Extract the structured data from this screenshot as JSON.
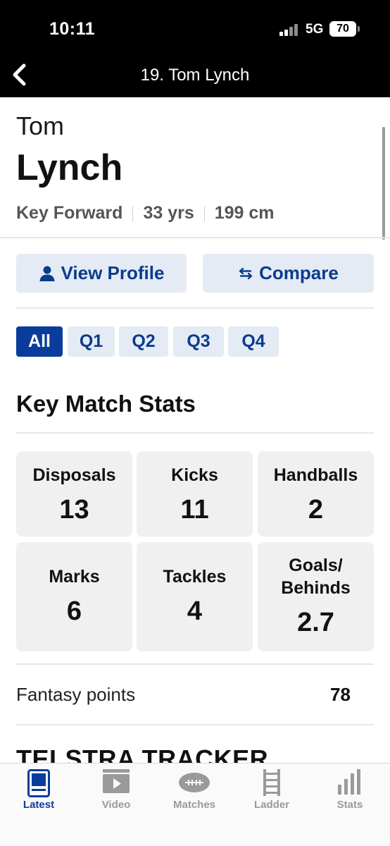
{
  "status_bar": {
    "time": "10:11",
    "network": "5G",
    "battery": "70"
  },
  "header": {
    "title": "19. Tom Lynch",
    "back_icon": "chevron-left-icon"
  },
  "player": {
    "first_name": "Tom",
    "last_name": "Lynch",
    "position": "Key Forward",
    "age": "33 yrs",
    "height": "199 cm"
  },
  "actions": {
    "view_profile": {
      "label": "View Profile",
      "icon": "person-icon"
    },
    "compare": {
      "label": "Compare",
      "icon": "swap-arrows-icon"
    }
  },
  "quarter_tabs": [
    {
      "label": "All",
      "active": true
    },
    {
      "label": "Q1",
      "active": false
    },
    {
      "label": "Q2",
      "active": false
    },
    {
      "label": "Q3",
      "active": false
    },
    {
      "label": "Q4",
      "active": false
    }
  ],
  "key_stats": {
    "title": "Key Match Stats",
    "items": [
      {
        "label": "Disposals",
        "value": "13"
      },
      {
        "label": "Kicks",
        "value": "11"
      },
      {
        "label": "Handballs",
        "value": "2"
      },
      {
        "label": "Marks",
        "value": "6"
      },
      {
        "label": "Tackles",
        "value": "4"
      },
      {
        "label_line1": "Goals/",
        "label_line2": "Behinds",
        "value": "2.7"
      }
    ]
  },
  "fantasy": {
    "label": "Fantasy points",
    "value": "78"
  },
  "tracker": {
    "title": "TELSTRA TRACKER"
  },
  "tabbar": [
    {
      "label": "Latest",
      "icon": "news-icon",
      "active": true
    },
    {
      "label": "Video",
      "icon": "video-icon",
      "active": false
    },
    {
      "label": "Matches",
      "icon": "football-icon",
      "active": false
    },
    {
      "label": "Ladder",
      "icon": "ladder-icon",
      "active": false
    },
    {
      "label": "Stats",
      "icon": "bar-chart-icon",
      "active": false
    }
  ],
  "colors": {
    "accent": "#0a3c9c",
    "button_bg": "#e4ebf4",
    "card_bg": "#f0f0f0"
  }
}
